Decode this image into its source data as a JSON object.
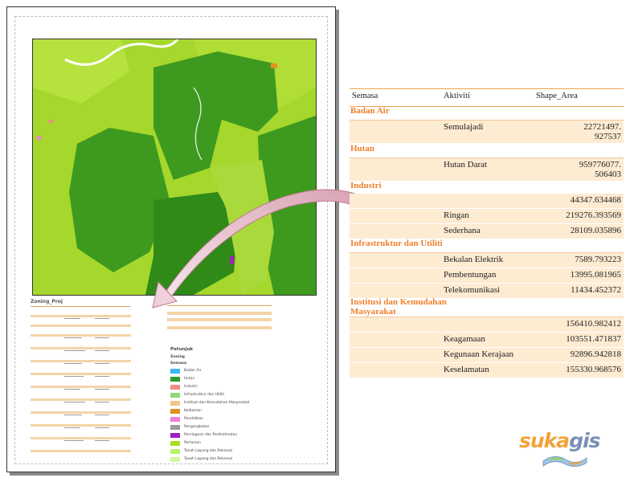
{
  "mini_report": {
    "title": "Zoning_Proj"
  },
  "legend": {
    "title": "Petunjuk",
    "subtitle": "Zoning",
    "group_label": "Semasa",
    "items": [
      {
        "label": "Badan Air",
        "color": "#3fb6f2"
      },
      {
        "label": "Hutan",
        "color": "#2f9b2f"
      },
      {
        "label": "Industri",
        "color": "#f08a8a"
      },
      {
        "label": "Infrastruktur dan Utiliti",
        "color": "#8fd87a"
      },
      {
        "label": "Institusi dan Kemudahan Masyarakat",
        "color": "#f3c58a"
      },
      {
        "label": "Kediaman",
        "color": "#e0901e"
      },
      {
        "label": "Pendidikan",
        "color": "#f07fd8"
      },
      {
        "label": "Pengangkutan",
        "color": "#9b9b9b"
      },
      {
        "label": "Perniagaan dan Perkhidmatan",
        "color": "#a020c0"
      },
      {
        "label": "Pertanian",
        "color": "#a8e020"
      },
      {
        "label": "Tanah Lapang dan Rekreasi",
        "color": "#b8f070"
      },
      {
        "label": "Tanah Lapang dan Rekreasi",
        "color": "#d0f7a0"
      }
    ]
  },
  "table": {
    "headers": {
      "col1": "Semasa",
      "col2": "Aktiviti",
      "col3": "Shape_Area"
    },
    "groups": [
      {
        "name": "Badan Air",
        "rows": [
          {
            "aktiviti": "Semulajadi",
            "area1": "22721497.",
            "area2": "927537"
          }
        ]
      },
      {
        "name": "Hutan",
        "rows": [
          {
            "aktiviti": "Hutan Darat",
            "area1": "959776077.",
            "area2": "506403"
          }
        ]
      },
      {
        "name": "Industri",
        "rows": [
          {
            "aktiviti": "",
            "area1": "44347.634468"
          },
          {
            "aktiviti": "Ringan",
            "area1": "219276.393569"
          },
          {
            "aktiviti": "Sederhana",
            "area1": "28109.035896"
          }
        ]
      },
      {
        "name": "Infrastruktur dan Utiliti",
        "rows": [
          {
            "aktiviti": "Bekalan Elektrik",
            "area1": "7589.793223"
          },
          {
            "aktiviti": "Pembentungan",
            "area1": "13995.081965"
          },
          {
            "aktiviti": "Telekomunikasi",
            "area1": "11434.452372"
          }
        ]
      },
      {
        "name1": "Institusi dan Kemudahan",
        "name2": "Masyarakat",
        "rows": [
          {
            "aktiviti": "",
            "area1": "156410.982412"
          },
          {
            "aktiviti": "Keagamaan",
            "area1": "103551.471837"
          },
          {
            "aktiviti": "Kegunaan Kerajaan",
            "area1": "92896.942818"
          },
          {
            "aktiviti": "Keselamatan",
            "area1": "155330.968576"
          }
        ]
      }
    ]
  },
  "logo": {
    "part1": "suka",
    "part2": "gis"
  },
  "colors": {
    "accent": "#f07f2a",
    "row_band": "#fdebd2",
    "map_base": "#a5d72c",
    "forest": "#3e9a1e"
  }
}
